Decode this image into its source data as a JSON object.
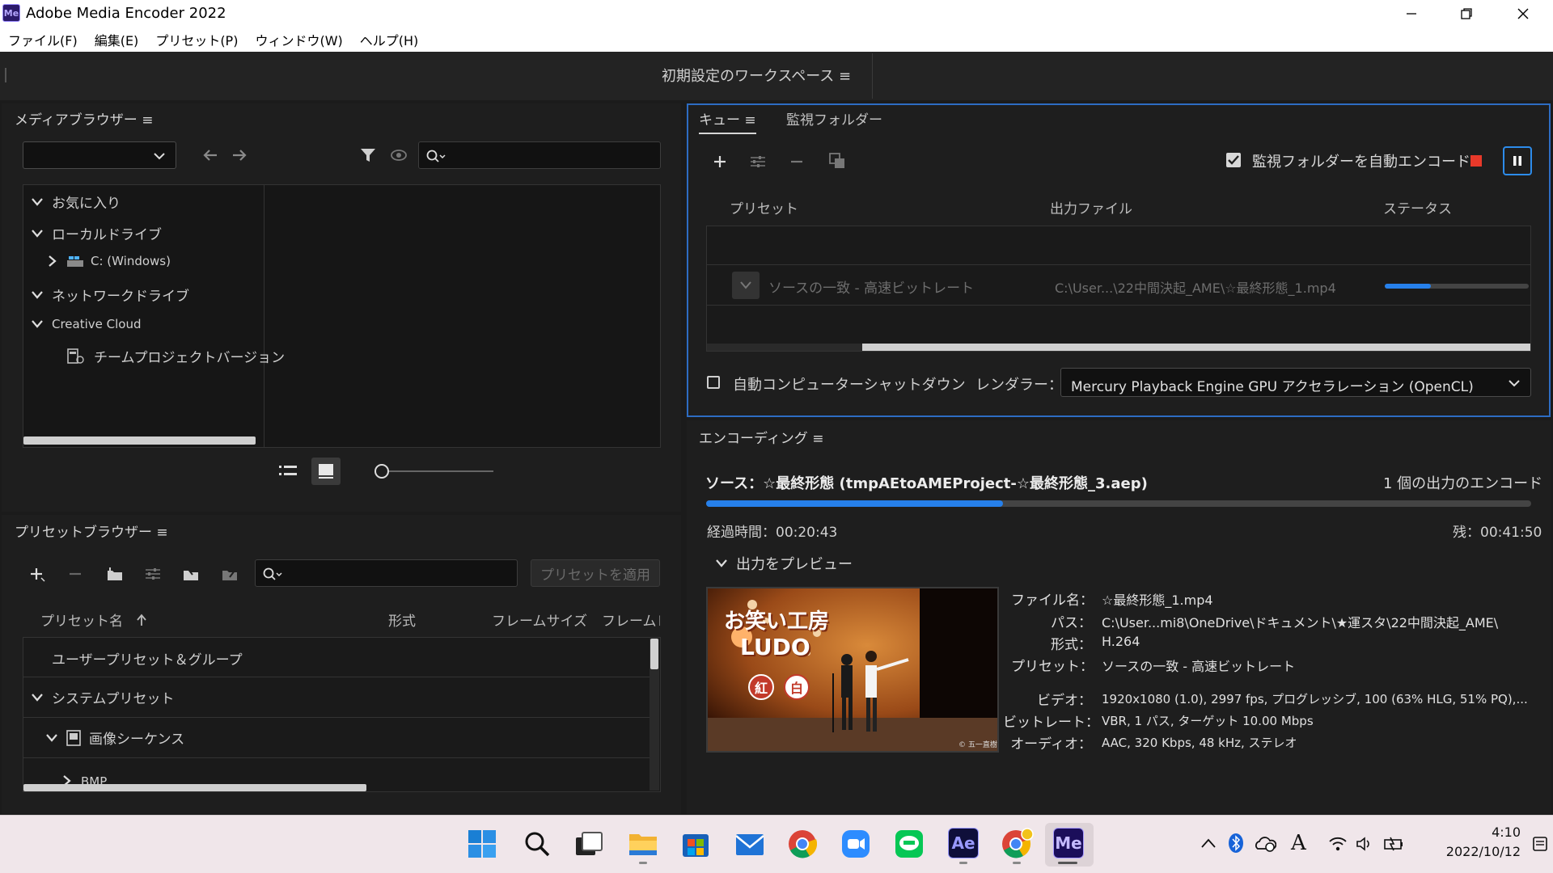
{
  "window": {
    "logo_text": "Me",
    "title": "Adobe Media Encoder 2022"
  },
  "menu": [
    "ファイル(F)",
    "編集(E)",
    "プリセット(P)",
    "ウィンドウ(W)",
    "ヘルプ(H)"
  ],
  "workspace": {
    "label": "初期設定のワークスペース ≡"
  },
  "media_browser": {
    "title": "メディアブラウザー ≡",
    "dropdown_value": "",
    "search_placeholder": "",
    "tree": [
      {
        "label": "お気に入り"
      },
      {
        "label": "ローカルドライブ"
      },
      {
        "label": "C: (Windows)"
      },
      {
        "label": "ネットワークドライブ"
      },
      {
        "label": "Creative Cloud"
      },
      {
        "label": "チームプロジェクトバージョン"
      }
    ]
  },
  "preset_browser": {
    "title": "プリセットブラウザー ≡",
    "apply_label": "プリセットを適用",
    "search_placeholder": "",
    "columns": [
      "プリセット名",
      "形式",
      "フレームサイズ",
      "フレームレ"
    ],
    "rows": [
      {
        "label": "ユーザープリセット＆グループ"
      },
      {
        "label": "システムプリセット"
      },
      {
        "label": "画像シーケンス"
      },
      {
        "label": "BMP"
      }
    ]
  },
  "queue": {
    "tab_queue": "キュー ≡",
    "tab_watch": "監視フォルダー",
    "auto_encode_label": "監視フォルダーを自動エンコード",
    "columns": [
      "プリセット",
      "出力ファイル",
      "ステータス"
    ],
    "item": {
      "preset": "ソースの一致 - 高速ビットレート",
      "output": "C:\\User...\\22中間決起_AME\\☆最終形態_1.mp4",
      "progress": 0.32
    },
    "shutdown_label": "自動コンピューターシャットダウン",
    "renderer_label": "レンダラー：",
    "renderer_value": "Mercury Playback Engine GPU アクセラレーション (OpenCL)"
  },
  "encoding": {
    "title": "エンコーディング ≡",
    "source": "ソース：☆最終形態 (tmpAEtoAMEProject-☆最終形態_3.aep)",
    "output_count": "1 個の出力のエンコード",
    "progress": 0.36,
    "elapsed": "経過時間：00:20:43",
    "remaining": "残：00:41:50",
    "preview_label": "出力をプレビュー",
    "thumbnail": {
      "line1": "お笑い工房",
      "line2": "LUDO",
      "badge1": "紅",
      "badge2": "白",
      "caption": "© 五一直樹"
    },
    "details": [
      {
        "key": "ファイル名：",
        "value": "☆最終形態_1.mp4"
      },
      {
        "key": "パス：",
        "value": "C:\\User...mi8\\OneDrive\\ドキュメント\\★運スタ\\22中間決起_AME\\"
      },
      {
        "key": "形式：",
        "value": "H.264"
      },
      {
        "key": "プリセット：",
        "value": "ソースの一致 - 高速ビットレート"
      },
      {
        "key": "ビデオ：",
        "value": "1920x1080 (1.0), 2997 fps, プログレッシブ, 100 (63% HLG, 51% PQ),..."
      },
      {
        "key": "ビットレート：",
        "value": "VBR, 1 パス, ターゲット 10.00 Mbps"
      },
      {
        "key": "オーディオ：",
        "value": "AAC, 320 Kbps, 48 kHz, ステレオ"
      }
    ]
  },
  "taskbar": {
    "ae_label": "Ae",
    "me_label": "Me",
    "time": "4:10",
    "date": "2022/10/12",
    "ime_label": "A"
  },
  "colors": {
    "accent_blue": "#2d8ceb",
    "progress_blue": "#2680eb",
    "stop_red": "#e8392a",
    "panel_bg": "#1e1e1e"
  }
}
